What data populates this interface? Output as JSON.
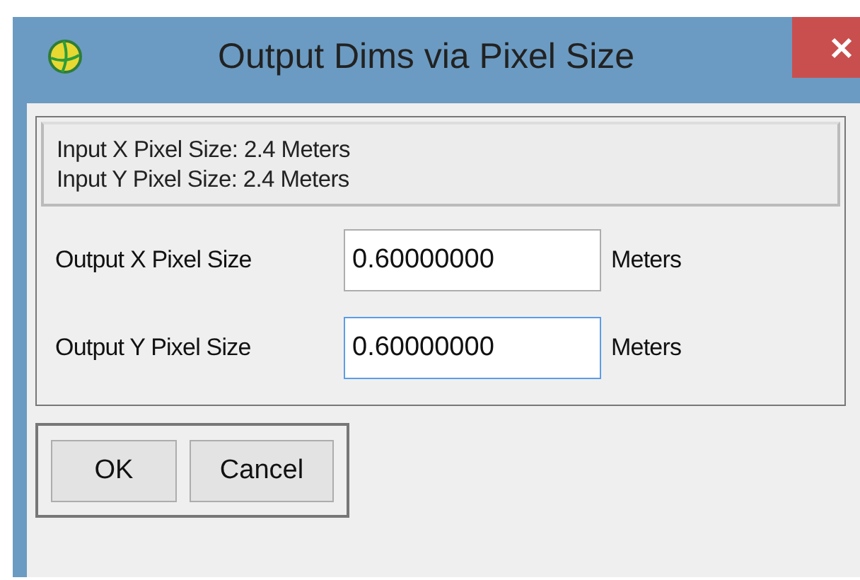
{
  "window": {
    "title": "Output Dims via Pixel Size"
  },
  "info": [
    "Input X Pixel Size: 2.4 Meters",
    "Input Y Pixel Size: 2.4 Meters"
  ],
  "fields": [
    {
      "label": "Output X Pixel Size",
      "value": "0.60000000",
      "unit": "Meters",
      "focused": false
    },
    {
      "label": "Output Y Pixel Size",
      "value": "0.60000000",
      "unit": "Meters",
      "focused": true
    }
  ],
  "buttons": [
    "OK",
    "Cancel"
  ]
}
